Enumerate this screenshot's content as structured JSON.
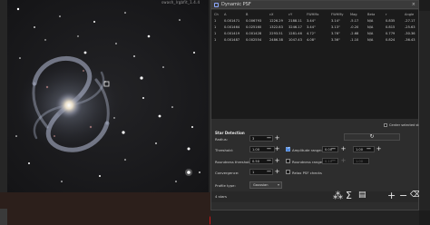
{
  "viewer": {
    "view_id": "swash_lrgbfit_1.4.4"
  },
  "window": {
    "title": "Dynamic PSF",
    "close_label": "×"
  },
  "table": {
    "headers": [
      "Ch",
      "A",
      "B",
      "cX",
      "cY",
      "FWHMx",
      "FWHMy",
      "Mag",
      "Beta",
      "r",
      "Angle",
      "MAD"
    ],
    "rows": [
      [
        "1",
        "0.001471",
        "0.006793",
        "1226.29",
        "2188.11",
        "3.44\"",
        "3.14\"",
        "-5.17",
        "N/A",
        "0.835",
        "-27.17",
        "1.20e-04"
      ],
      [
        "1",
        "0.001464",
        "0.025160",
        "1322.83",
        "3246.17",
        "3.44\"",
        "3.13\"",
        "-0.20",
        "N/A",
        "0.815",
        "-25.63",
        "1.02e-04"
      ],
      [
        "1",
        "0.001419",
        "0.001428",
        "2293.51",
        "1281.46",
        "4.72\"",
        "3.76\"",
        "-2.68",
        "N/A",
        "0.779",
        "-30.36",
        "1.31e-04"
      ],
      [
        "1",
        "0.001487",
        "0.002554",
        "2486.38",
        "1047.43",
        "4.08\"",
        "3.36\"",
        "-1.10",
        "N/A",
        "0.824",
        "-36.43",
        "8.74e-05"
      ]
    ]
  },
  "detection": {
    "center_selected": "Center selected star",
    "section_title": "Star Detection",
    "radius_label": "Radius:",
    "radius_value": "3",
    "refresh_icon": "↻",
    "threshold_label": "Threshold:",
    "threshold_value": "1.00",
    "amplitude_label": "Amplitude range:",
    "amplitude_min": "0.00",
    "amplitude_max": "1.00",
    "roundness_label": "Roundness threshold:",
    "roundness_value": "0.50",
    "roundness_range_label": "Roundness range:",
    "roundness_min": "0.10",
    "roundness_max": "1.00",
    "convergence_label": "Convergence:",
    "convergence_value": "1",
    "relax_label": "Relax PSF checks",
    "profile_label": "Profile type:",
    "profile_value": "Gaussian"
  },
  "footer": {
    "star_count": "4 stars"
  },
  "colors": {
    "accent": "#3a7ad6",
    "danger": "#d01818"
  }
}
